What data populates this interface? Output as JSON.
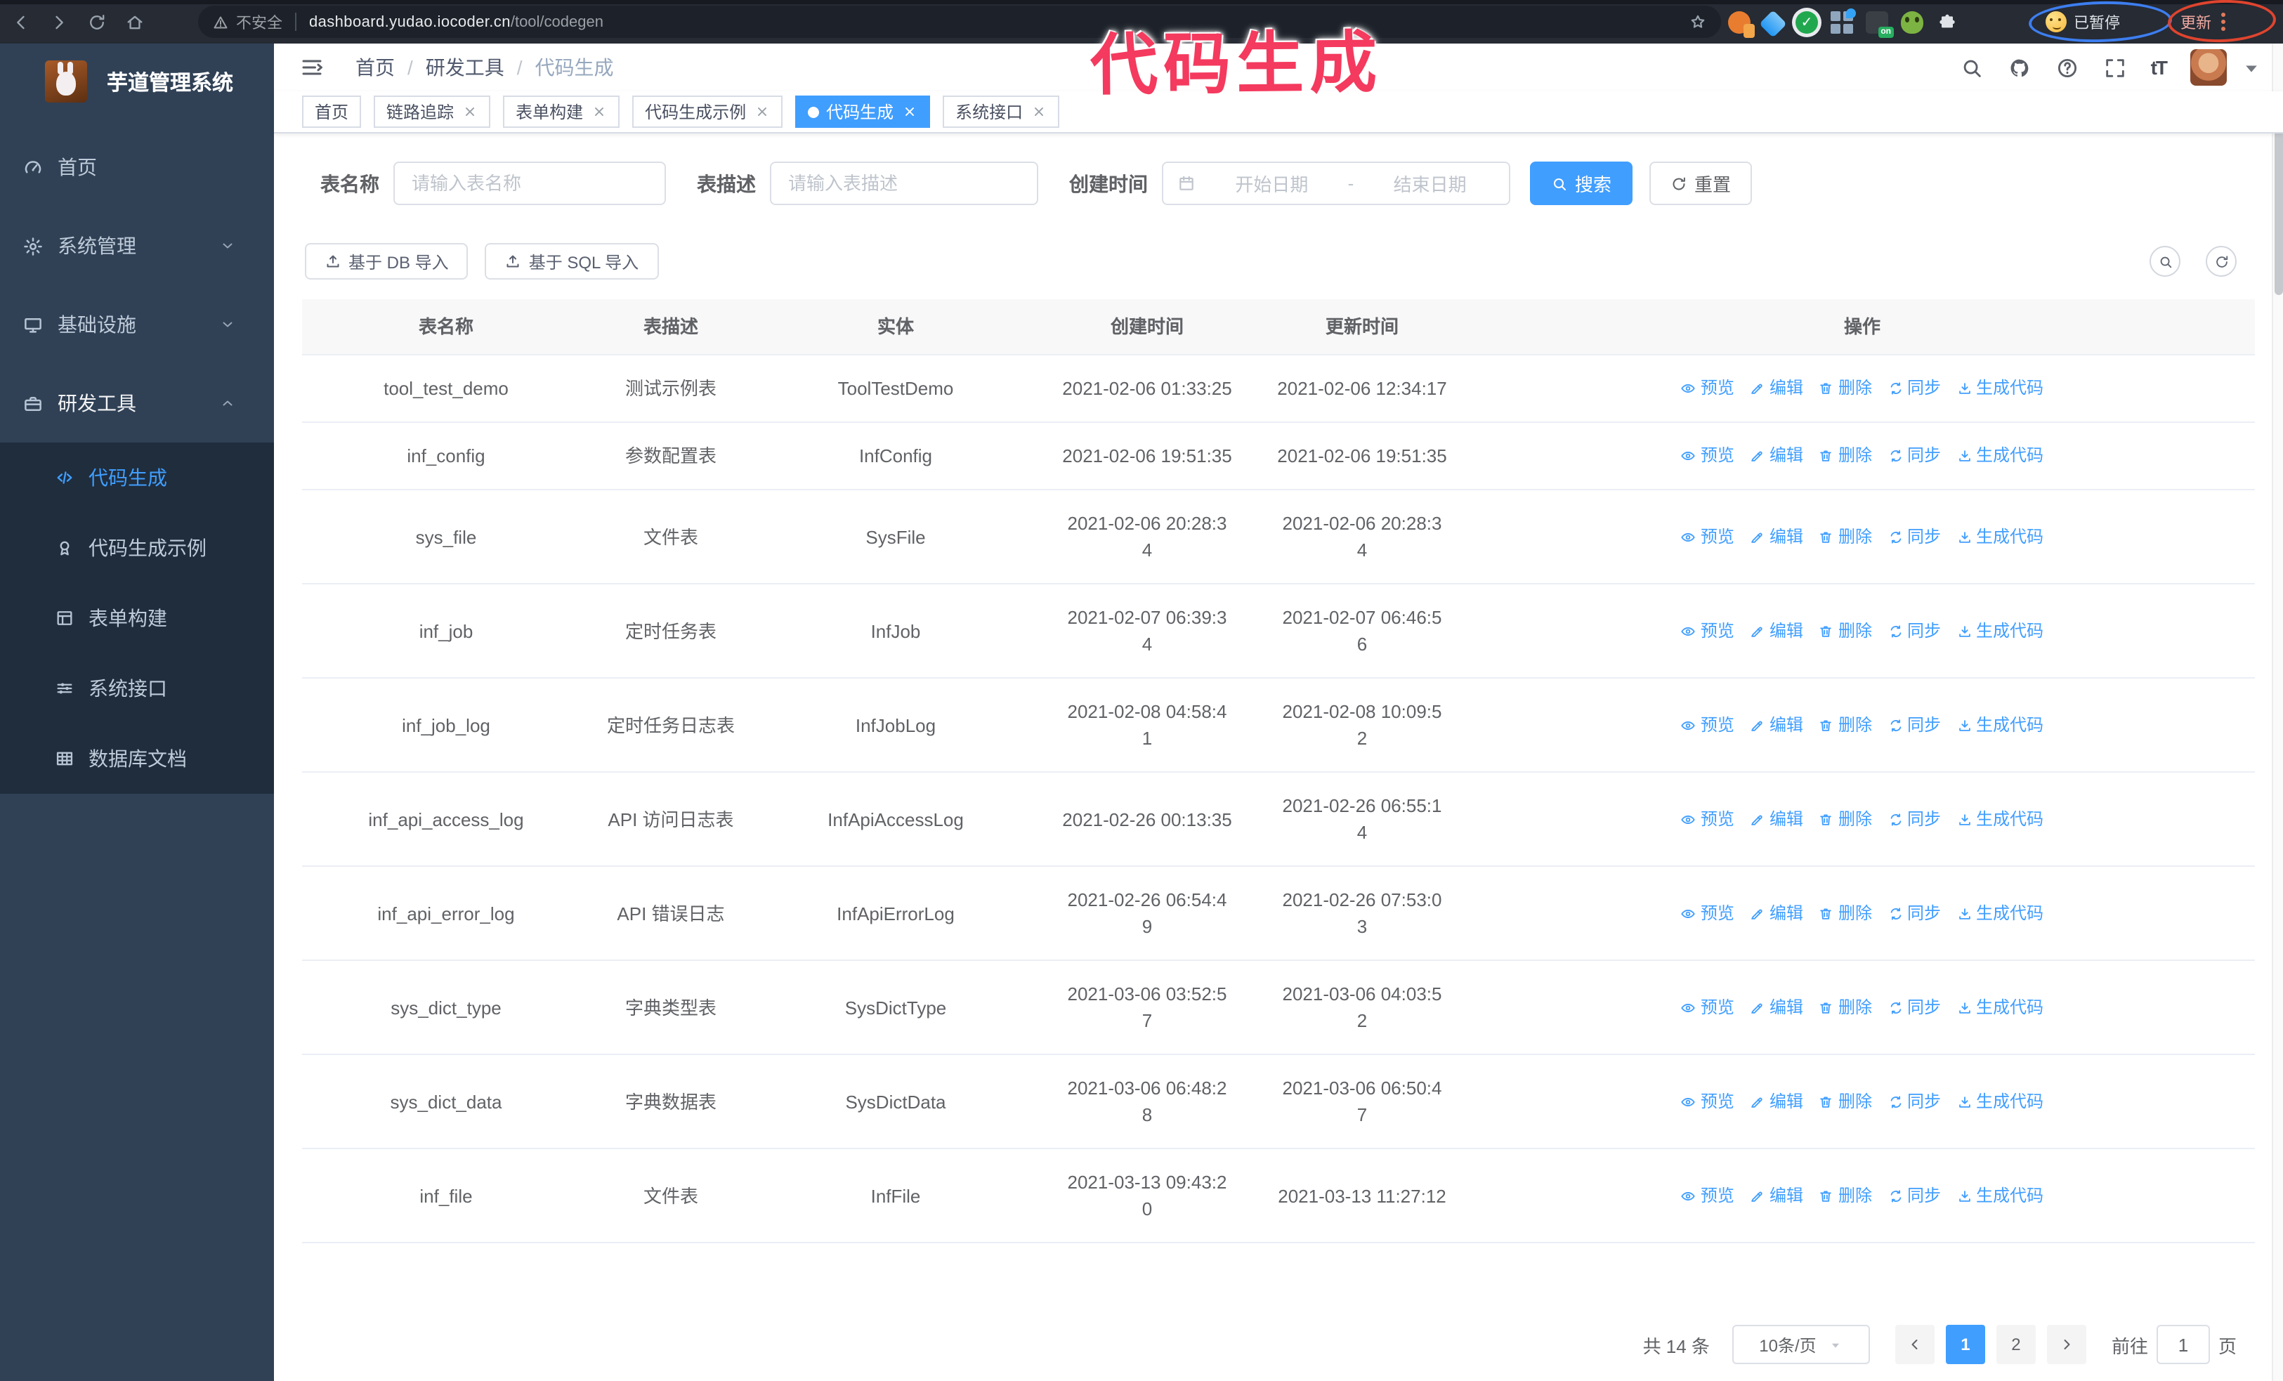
{
  "colors": {
    "accent": "#409EFF",
    "sidebar_bg": "#304156",
    "submenu_bg": "#1f2d3d",
    "annotation": "#f43a5e",
    "browser_bar": "#262b34"
  },
  "browser": {
    "security_label": "不安全",
    "url_domain": "dashboard.yudao.iocoder.cn",
    "url_path": "/tool/codegen",
    "extensions": [
      {
        "name": "extension-orange-icon",
        "style": "orange"
      },
      {
        "name": "extension-gem-icon",
        "style": "gem"
      },
      {
        "name": "extension-green-check-icon",
        "style": "check",
        "glyph": "✓"
      },
      {
        "name": "extension-grid-icon",
        "style": "grid"
      },
      {
        "name": "extension-dark-icon",
        "style": "on",
        "badge": "on"
      },
      {
        "name": "extension-alien-icon",
        "style": "alien"
      },
      {
        "name": "extension-puzzle-icon",
        "style": "puzzle"
      }
    ],
    "profile_badge": "已暂停",
    "update_button": "更新"
  },
  "annotation": {
    "text": "代码生成"
  },
  "app": {
    "logo_title": "芋道管理系统",
    "breadcrumb": [
      "首页",
      "研发工具",
      "代码生成"
    ],
    "breadcrumb_separator": "/",
    "sidebar": {
      "items": [
        {
          "label": "首页",
          "icon": "dashboard-icon"
        },
        {
          "label": "系统管理",
          "icon": "gear-icon",
          "chevron": "down"
        },
        {
          "label": "基础设施",
          "icon": "monitor-icon",
          "chevron": "down"
        },
        {
          "label": "研发工具",
          "icon": "toolbox-icon",
          "chevron": "up",
          "active_parent": true,
          "children": [
            {
              "label": "代码生成",
              "icon": "code-icon",
              "active": true
            },
            {
              "label": "代码生成示例",
              "icon": "medal-icon"
            },
            {
              "label": "表单构建",
              "icon": "form-icon"
            },
            {
              "label": "系统接口",
              "icon": "sliders-icon"
            },
            {
              "label": "数据库文档",
              "icon": "db-table-icon"
            }
          ]
        }
      ]
    },
    "header": {
      "icons": [
        "search-icon",
        "github-icon",
        "help-icon",
        "fullscreen-icon"
      ],
      "font_size_label": "tT"
    },
    "tabs": [
      {
        "label": "首页",
        "closable": false,
        "active": false
      },
      {
        "label": "链路追踪",
        "closable": true,
        "active": false
      },
      {
        "label": "表单构建",
        "closable": true,
        "active": false
      },
      {
        "label": "代码生成示例",
        "closable": true,
        "active": false
      },
      {
        "label": "代码生成",
        "closable": true,
        "active": true
      },
      {
        "label": "系统接口",
        "closable": true,
        "active": false
      }
    ],
    "filters": {
      "table_name_label": "表名称",
      "table_name_placeholder": "请输入表名称",
      "table_desc_label": "表描述",
      "table_desc_placeholder": "请输入表描述",
      "create_time_label": "创建时间",
      "date_start_placeholder": "开始日期",
      "date_separator": "-",
      "date_end_placeholder": "结束日期",
      "search_label": "搜索",
      "reset_label": "重置"
    },
    "toolbar": {
      "import_db_label": "基于 DB 导入",
      "import_sql_label": "基于 SQL 导入"
    },
    "table": {
      "columns": [
        "表名称",
        "表描述",
        "实体",
        "创建时间",
        "更新时间",
        "操作"
      ],
      "actions": [
        "预览",
        "编辑",
        "删除",
        "同步",
        "生成代码"
      ],
      "action_icons": [
        "eye-icon",
        "edit-icon",
        "delete-icon",
        "sync-icon",
        "download-icon"
      ],
      "rows": [
        {
          "name": "tool_test_demo",
          "desc": "测试示例表",
          "entity": "ToolTestDemo",
          "create_time": "2021-02-06 01:33:25",
          "update_time": "2021-02-06 12:34:17"
        },
        {
          "name": "inf_config",
          "desc": "参数配置表",
          "entity": "InfConfig",
          "create_time": "2021-02-06 19:51:35",
          "update_time": "2021-02-06 19:51:35"
        },
        {
          "name": "sys_file",
          "desc": "文件表",
          "entity": "SysFile",
          "create_time": "2021-02-06 20:28:3\n4",
          "update_time": "2021-02-06 20:28:3\n4"
        },
        {
          "name": "inf_job",
          "desc": "定时任务表",
          "entity": "InfJob",
          "create_time": "2021-02-07 06:39:3\n4",
          "update_time": "2021-02-07 06:46:5\n6"
        },
        {
          "name": "inf_job_log",
          "desc": "定时任务日志表",
          "entity": "InfJobLog",
          "create_time": "2021-02-08 04:58:4\n1",
          "update_time": "2021-02-08 10:09:5\n2"
        },
        {
          "name": "inf_api_access_log",
          "desc": "API 访问日志表",
          "entity": "InfApiAccessLog",
          "create_time": "2021-02-26 00:13:35",
          "update_time": "2021-02-26 06:55:1\n4"
        },
        {
          "name": "inf_api_error_log",
          "desc": "API 错误日志",
          "entity": "InfApiErrorLog",
          "create_time": "2021-02-26 06:54:4\n9",
          "update_time": "2021-02-26 07:53:0\n3"
        },
        {
          "name": "sys_dict_type",
          "desc": "字典类型表",
          "entity": "SysDictType",
          "create_time": "2021-03-06 03:52:5\n7",
          "update_time": "2021-03-06 04:03:5\n2"
        },
        {
          "name": "sys_dict_data",
          "desc": "字典数据表",
          "entity": "SysDictData",
          "create_time": "2021-03-06 06:48:2\n8",
          "update_time": "2021-03-06 06:50:4\n7"
        },
        {
          "name": "inf_file",
          "desc": "文件表",
          "entity": "InfFile",
          "create_time": "2021-03-13 09:43:2\n0",
          "update_time": "2021-03-13 11:27:12"
        }
      ]
    },
    "pagination": {
      "total_label": "共 14 条",
      "page_size_label": "10条/页",
      "pages": [
        "1",
        "2"
      ],
      "active_page": "1",
      "goto_label": "前往",
      "goto_value": "1",
      "goto_suffix": "页"
    }
  }
}
